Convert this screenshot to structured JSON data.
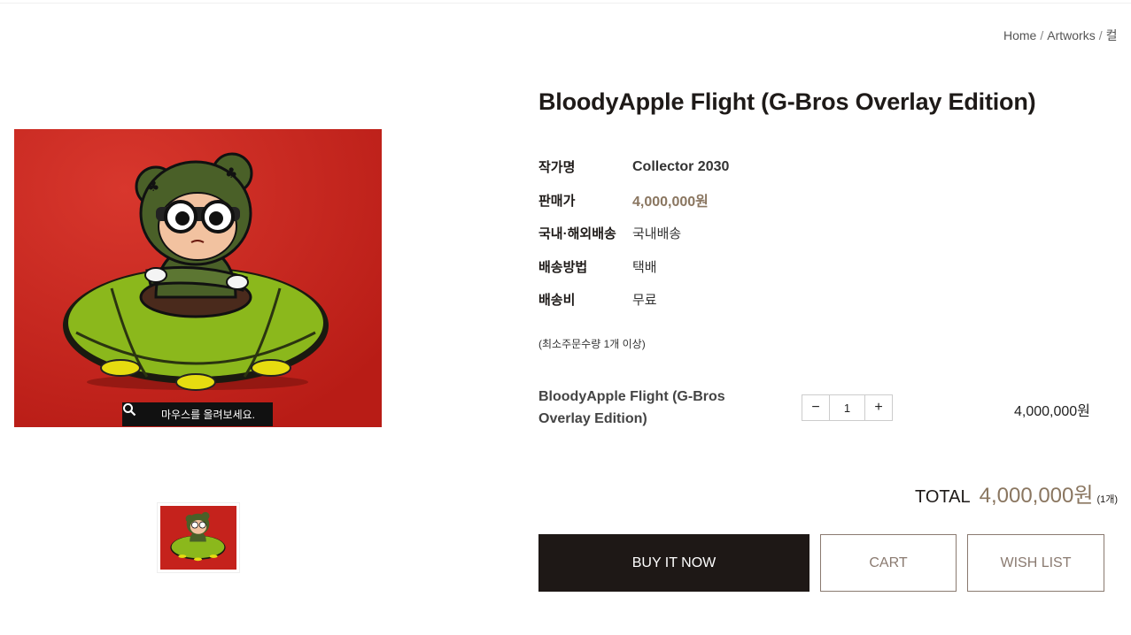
{
  "breadcrumb": {
    "home": "Home",
    "sep1": "/",
    "artworks": "Artworks",
    "sep2": "/",
    "current": "컬"
  },
  "gallery": {
    "zoom_hint": "마우스를 올려보세요."
  },
  "product": {
    "title": "BloodyApple Flight (G-Bros Overlay Edition)",
    "specs": [
      {
        "label": "작가명",
        "value": "Collector 2030"
      },
      {
        "label": "판매가",
        "value": "4,000,000원"
      },
      {
        "label": "국내·해외배송",
        "value": "국내배송"
      },
      {
        "label": "배송방법",
        "value": "택배"
      },
      {
        "label": "배송비",
        "value": "무료"
      }
    ],
    "min_order": "(최소주문수량 1개 이상)"
  },
  "option": {
    "name": "BloodyApple Flight (G-Bros Overlay Edition)",
    "decrease": "−",
    "quantity": "1",
    "increase": "+",
    "price": "4,000,000원"
  },
  "total": {
    "label": "TOTAL",
    "amount": "4,000,000원",
    "count": "(1개)"
  },
  "actions": {
    "buy": "BUY IT NOW",
    "cart": "CART",
    "wish": "WISH LIST"
  },
  "colors": {
    "accent_price": "#8a7660",
    "button_dark": "#1e1816",
    "artwork_bg": "#c5221c",
    "ufo_green": "#8bb81c"
  },
  "icons": {
    "zoom": "search-icon"
  }
}
